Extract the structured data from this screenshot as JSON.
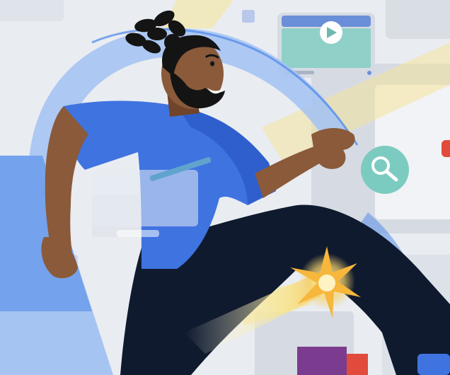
{
  "illustration": {
    "palette": {
      "background": "#e9ecf1",
      "window_frame": "#d6dbe3",
      "window_light": "#f1f3f6",
      "video_bar": "#6a8fd8",
      "video_screen": "#8fd0c8",
      "play_circle": "#ffffff",
      "play_triangle": "#6fb9b0",
      "arc_blue": "#a6c4f2",
      "arc_blue_dark": "#4a86e8",
      "shirt": "#3f73e0",
      "shirt_shadow": "#2f5fcd",
      "skin": "#8a5a3a",
      "skin_shadow": "#6f442a",
      "hair": "#141414",
      "pants": "#0f1a2e",
      "spark": "#f6b73c",
      "spark_core": "#fff3c4",
      "yellow_stripe": "#f7e48c",
      "search_circle": "#7ccbc0",
      "red_accent": "#e04b3c",
      "purple_accent": "#7b3c8f"
    },
    "icons": {
      "play": "play-icon",
      "search": "search-icon",
      "star_burst": "spark-icon"
    }
  }
}
